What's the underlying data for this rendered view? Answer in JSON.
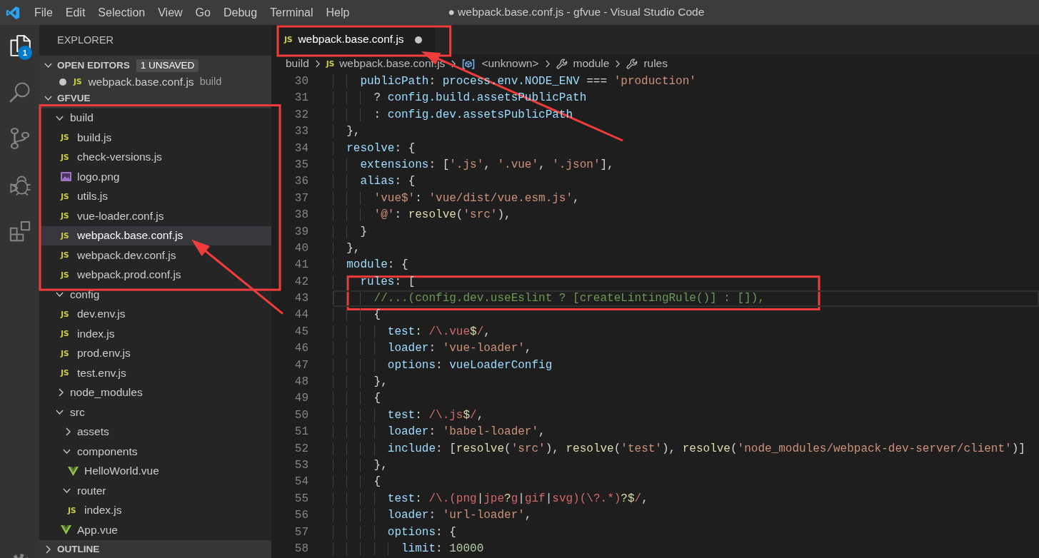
{
  "window": {
    "title": "● webpack.base.conf.js - gfvue - Visual Studio Code"
  },
  "menu": [
    "File",
    "Edit",
    "Selection",
    "View",
    "Go",
    "Debug",
    "Terminal",
    "Help"
  ],
  "activity_bar": [
    {
      "kind": "files",
      "selected": true,
      "badge": "1"
    },
    {
      "kind": "search",
      "selected": false
    },
    {
      "kind": "source-control",
      "selected": false
    },
    {
      "kind": "debug",
      "selected": false
    },
    {
      "kind": "extensions",
      "selected": false
    },
    {
      "kind": "settings",
      "selected": false
    }
  ],
  "sidebar": {
    "title": "EXPLORER",
    "sections": [
      {
        "title": "OPEN EDITORS",
        "expanded": true,
        "badge": "1 UNSAVED",
        "items": [
          {
            "name": "webpack.base.conf.js",
            "icon_text": "JS",
            "description": "build",
            "unsaved": true
          }
        ]
      },
      {
        "title": "GFVUE",
        "expanded": true,
        "tree": [
          {
            "name": "build",
            "kind": "folder",
            "expanded": true,
            "selected": false,
            "framed": true,
            "pointed": false,
            "children": [
              {
                "name": "build.js",
                "kind": "js",
                "icon_text": "JS",
                "selected": false,
                "framed": false,
                "pointed": false
              },
              {
                "name": "check-versions.js",
                "kind": "js",
                "icon_text": "JS",
                "selected": false,
                "framed": false,
                "pointed": false
              },
              {
                "name": "logo.png",
                "kind": "image",
                "selected": false,
                "framed": false,
                "pointed": false
              },
              {
                "name": "utils.js",
                "kind": "js",
                "icon_text": "JS",
                "selected": false,
                "framed": false,
                "pointed": false
              },
              {
                "name": "vue-loader.conf.js",
                "kind": "js",
                "icon_text": "JS",
                "selected": false,
                "framed": false,
                "pointed": false
              },
              {
                "name": "webpack.base.conf.js",
                "kind": "js",
                "icon_text": "JS",
                "selected": true,
                "framed": false,
                "pointed": true
              },
              {
                "name": "webpack.dev.conf.js",
                "kind": "js",
                "icon_text": "JS",
                "selected": false,
                "framed": false,
                "pointed": false
              },
              {
                "name": "webpack.prod.conf.js",
                "kind": "js",
                "icon_text": "JS",
                "selected": false,
                "framed": false,
                "pointed": false
              }
            ]
          },
          {
            "name": "config",
            "kind": "folder",
            "expanded": true,
            "selected": false,
            "framed": false,
            "pointed": false,
            "children": [
              {
                "name": "dev.env.js",
                "kind": "js",
                "icon_text": "JS",
                "selected": false,
                "framed": false,
                "pointed": false
              },
              {
                "name": "index.js",
                "kind": "js",
                "icon_text": "JS",
                "selected": false,
                "framed": false,
                "pointed": false
              },
              {
                "name": "prod.env.js",
                "kind": "js",
                "icon_text": "JS",
                "selected": false,
                "framed": false,
                "pointed": false
              },
              {
                "name": "test.env.js",
                "kind": "js",
                "icon_text": "JS",
                "selected": false,
                "framed": false,
                "pointed": false
              }
            ]
          },
          {
            "name": "node_modules",
            "kind": "folder",
            "expanded": false,
            "selected": false,
            "framed": false,
            "pointed": false
          },
          {
            "name": "src",
            "kind": "folder",
            "expanded": true,
            "selected": false,
            "framed": false,
            "pointed": false,
            "children": [
              {
                "name": "assets",
                "kind": "folder",
                "expanded": false,
                "selected": false,
                "framed": false,
                "pointed": false
              },
              {
                "name": "components",
                "kind": "folder",
                "expanded": true,
                "selected": false,
                "framed": false,
                "pointed": false,
                "children": [
                  {
                    "name": "HelloWorld.vue",
                    "kind": "vue",
                    "selected": false,
                    "framed": false,
                    "pointed": false
                  }
                ]
              },
              {
                "name": "router",
                "kind": "folder",
                "expanded": true,
                "selected": false,
                "framed": false,
                "pointed": false,
                "children": [
                  {
                    "name": "index.js",
                    "kind": "js",
                    "icon_text": "JS",
                    "selected": false,
                    "framed": false,
                    "pointed": false
                  }
                ]
              },
              {
                "name": "App.vue",
                "kind": "vue",
                "selected": false,
                "framed": false,
                "pointed": false
              }
            ]
          }
        ]
      },
      {
        "title": "OUTLINE",
        "expanded": false
      }
    ]
  },
  "editor": {
    "tabs": [
      {
        "title": "webpack.base.conf.js",
        "icon_text": "JS",
        "selected": true,
        "unsaved": true,
        "framed": true,
        "pointed": true
      }
    ],
    "breadcrumbs": [
      {
        "kind": "folder",
        "text": "build"
      },
      {
        "kind": "js",
        "icon_text": "JS",
        "text": "webpack.base.conf.js"
      },
      {
        "kind": "object",
        "text": "<unknown>"
      },
      {
        "kind": "property",
        "text": "module"
      },
      {
        "kind": "property",
        "text": "rules"
      }
    ],
    "lines": [
      {
        "number": "30",
        "current": false,
        "framed": false,
        "tokens": [
          {
            "kind": "property",
            "text": "    publicPath"
          },
          {
            "kind": "punctuation",
            "text": ": "
          },
          {
            "kind": "variable",
            "text": "process.env.NODE_ENV"
          },
          {
            "kind": "punctuation",
            "text": " === "
          },
          {
            "kind": "string",
            "text": "'production'"
          }
        ]
      },
      {
        "number": "31",
        "current": false,
        "framed": false,
        "tokens": [
          {
            "kind": "punctuation",
            "text": "      ? "
          },
          {
            "kind": "variable",
            "text": "config.build.assetsPublicPath"
          }
        ]
      },
      {
        "number": "32",
        "current": false,
        "framed": false,
        "tokens": [
          {
            "kind": "punctuation",
            "text": "      : "
          },
          {
            "kind": "variable",
            "text": "config.dev.assetsPublicPath"
          }
        ]
      },
      {
        "number": "33",
        "current": false,
        "framed": false,
        "tokens": [
          {
            "kind": "punctuation",
            "text": "  },"
          }
        ]
      },
      {
        "number": "34",
        "current": false,
        "framed": false,
        "tokens": [
          {
            "kind": "property",
            "text": "  resolve"
          },
          {
            "kind": "punctuation",
            "text": ": {"
          }
        ]
      },
      {
        "number": "35",
        "current": false,
        "framed": false,
        "tokens": [
          {
            "kind": "property",
            "text": "    extensions"
          },
          {
            "kind": "punctuation",
            "text": ": ["
          },
          {
            "kind": "string",
            "text": "'.js'"
          },
          {
            "kind": "punctuation",
            "text": ", "
          },
          {
            "kind": "string",
            "text": "'.vue'"
          },
          {
            "kind": "punctuation",
            "text": ", "
          },
          {
            "kind": "string",
            "text": "'.json'"
          },
          {
            "kind": "punctuation",
            "text": "],"
          }
        ]
      },
      {
        "number": "36",
        "current": false,
        "framed": false,
        "tokens": [
          {
            "kind": "property",
            "text": "    alias"
          },
          {
            "kind": "punctuation",
            "text": ": {"
          }
        ]
      },
      {
        "number": "37",
        "current": false,
        "framed": false,
        "tokens": [
          {
            "kind": "string",
            "text": "      'vue$'"
          },
          {
            "kind": "punctuation",
            "text": ": "
          },
          {
            "kind": "string",
            "text": "'vue/dist/vue.esm.js'"
          },
          {
            "kind": "punctuation",
            "text": ","
          }
        ]
      },
      {
        "number": "38",
        "current": false,
        "framed": false,
        "tokens": [
          {
            "kind": "string",
            "text": "      '@'"
          },
          {
            "kind": "punctuation",
            "text": ": "
          },
          {
            "kind": "function",
            "text": "resolve"
          },
          {
            "kind": "punctuation",
            "text": "("
          },
          {
            "kind": "string",
            "text": "'src'"
          },
          {
            "kind": "punctuation",
            "text": "),"
          }
        ]
      },
      {
        "number": "39",
        "current": false,
        "framed": false,
        "tokens": [
          {
            "kind": "punctuation",
            "text": "    }"
          }
        ]
      },
      {
        "number": "40",
        "current": false,
        "framed": false,
        "tokens": [
          {
            "kind": "punctuation",
            "text": "  },"
          }
        ]
      },
      {
        "number": "41",
        "current": false,
        "framed": false,
        "tokens": [
          {
            "kind": "property",
            "text": "  module"
          },
          {
            "kind": "punctuation",
            "text": ": {"
          }
        ]
      },
      {
        "number": "42",
        "current": false,
        "framed": true,
        "tokens": [
          {
            "kind": "property",
            "text": "    rules"
          },
          {
            "kind": "punctuation",
            "text": ": ["
          }
        ]
      },
      {
        "number": "43",
        "current": true,
        "framed": true,
        "tokens": [
          {
            "kind": "comment",
            "text": "      //...(config.dev.useEslint ? [createLintingRule()] : []),"
          }
        ]
      },
      {
        "number": "44",
        "current": false,
        "framed": false,
        "tokens": [
          {
            "kind": "punctuation",
            "text": "      {"
          }
        ]
      },
      {
        "number": "45",
        "current": false,
        "framed": false,
        "tokens": [
          {
            "kind": "property",
            "text": "        test"
          },
          {
            "kind": "punctuation",
            "text": ": "
          },
          {
            "kind": "regex",
            "text": "/\\.vue"
          },
          {
            "kind": "regex-anchor",
            "text": "$"
          },
          {
            "kind": "regex",
            "text": "/"
          },
          {
            "kind": "punctuation",
            "text": ","
          }
        ]
      },
      {
        "number": "46",
        "current": false,
        "framed": false,
        "tokens": [
          {
            "kind": "property",
            "text": "        loader"
          },
          {
            "kind": "punctuation",
            "text": ": "
          },
          {
            "kind": "string",
            "text": "'vue-loader'"
          },
          {
            "kind": "punctuation",
            "text": ","
          }
        ]
      },
      {
        "number": "47",
        "current": false,
        "framed": false,
        "tokens": [
          {
            "kind": "property",
            "text": "        options"
          },
          {
            "kind": "punctuation",
            "text": ": "
          },
          {
            "kind": "variable",
            "text": "vueLoaderConfig"
          }
        ]
      },
      {
        "number": "48",
        "current": false,
        "framed": false,
        "tokens": [
          {
            "kind": "punctuation",
            "text": "      },"
          }
        ]
      },
      {
        "number": "49",
        "current": false,
        "framed": false,
        "tokens": [
          {
            "kind": "punctuation",
            "text": "      {"
          }
        ]
      },
      {
        "number": "50",
        "current": false,
        "framed": false,
        "tokens": [
          {
            "kind": "property",
            "text": "        test"
          },
          {
            "kind": "punctuation",
            "text": ": "
          },
          {
            "kind": "regex",
            "text": "/\\.js"
          },
          {
            "kind": "regex-anchor",
            "text": "$"
          },
          {
            "kind": "regex",
            "text": "/"
          },
          {
            "kind": "punctuation",
            "text": ","
          }
        ]
      },
      {
        "number": "51",
        "current": false,
        "framed": false,
        "tokens": [
          {
            "kind": "property",
            "text": "        loader"
          },
          {
            "kind": "punctuation",
            "text": ": "
          },
          {
            "kind": "string",
            "text": "'babel-loader'"
          },
          {
            "kind": "punctuation",
            "text": ","
          }
        ]
      },
      {
        "number": "52",
        "current": false,
        "framed": false,
        "tokens": [
          {
            "kind": "property",
            "text": "        include"
          },
          {
            "kind": "punctuation",
            "text": ": ["
          },
          {
            "kind": "function",
            "text": "resolve"
          },
          {
            "kind": "punctuation",
            "text": "("
          },
          {
            "kind": "string",
            "text": "'src'"
          },
          {
            "kind": "punctuation",
            "text": "), "
          },
          {
            "kind": "function",
            "text": "resolve"
          },
          {
            "kind": "punctuation",
            "text": "("
          },
          {
            "kind": "string",
            "text": "'test'"
          },
          {
            "kind": "punctuation",
            "text": "), "
          },
          {
            "kind": "function",
            "text": "resolve"
          },
          {
            "kind": "punctuation",
            "text": "("
          },
          {
            "kind": "string",
            "text": "'node_modules/webpack-dev-server/client'"
          },
          {
            "kind": "punctuation",
            "text": ")]"
          }
        ]
      },
      {
        "number": "53",
        "current": false,
        "framed": false,
        "tokens": [
          {
            "kind": "punctuation",
            "text": "      },"
          }
        ]
      },
      {
        "number": "54",
        "current": false,
        "framed": false,
        "tokens": [
          {
            "kind": "punctuation",
            "text": "      {"
          }
        ]
      },
      {
        "number": "55",
        "current": false,
        "framed": false,
        "tokens": [
          {
            "kind": "property",
            "text": "        test"
          },
          {
            "kind": "punctuation",
            "text": ": "
          },
          {
            "kind": "regex",
            "text": "/\\.(png"
          },
          {
            "kind": "punctuation",
            "text": "|"
          },
          {
            "kind": "regex",
            "text": "jpe"
          },
          {
            "kind": "regex-anchor",
            "text": "?"
          },
          {
            "kind": "regex",
            "text": "g"
          },
          {
            "kind": "punctuation",
            "text": "|"
          },
          {
            "kind": "regex",
            "text": "gif"
          },
          {
            "kind": "punctuation",
            "text": "|"
          },
          {
            "kind": "regex",
            "text": "svg)(\\?.*)"
          },
          {
            "kind": "regex-anchor",
            "text": "?$"
          },
          {
            "kind": "regex",
            "text": "/"
          },
          {
            "kind": "punctuation",
            "text": ","
          }
        ]
      },
      {
        "number": "56",
        "current": false,
        "framed": false,
        "tokens": [
          {
            "kind": "property",
            "text": "        loader"
          },
          {
            "kind": "punctuation",
            "text": ": "
          },
          {
            "kind": "string",
            "text": "'url-loader'"
          },
          {
            "kind": "punctuation",
            "text": ","
          }
        ]
      },
      {
        "number": "57",
        "current": false,
        "framed": false,
        "tokens": [
          {
            "kind": "property",
            "text": "        options"
          },
          {
            "kind": "punctuation",
            "text": ": {"
          }
        ]
      },
      {
        "number": "58",
        "current": false,
        "framed": false,
        "tokens": [
          {
            "kind": "property",
            "text": "          limit"
          },
          {
            "kind": "punctuation",
            "text": ": "
          },
          {
            "kind": "number",
            "text": "10000"
          }
        ]
      }
    ]
  }
}
